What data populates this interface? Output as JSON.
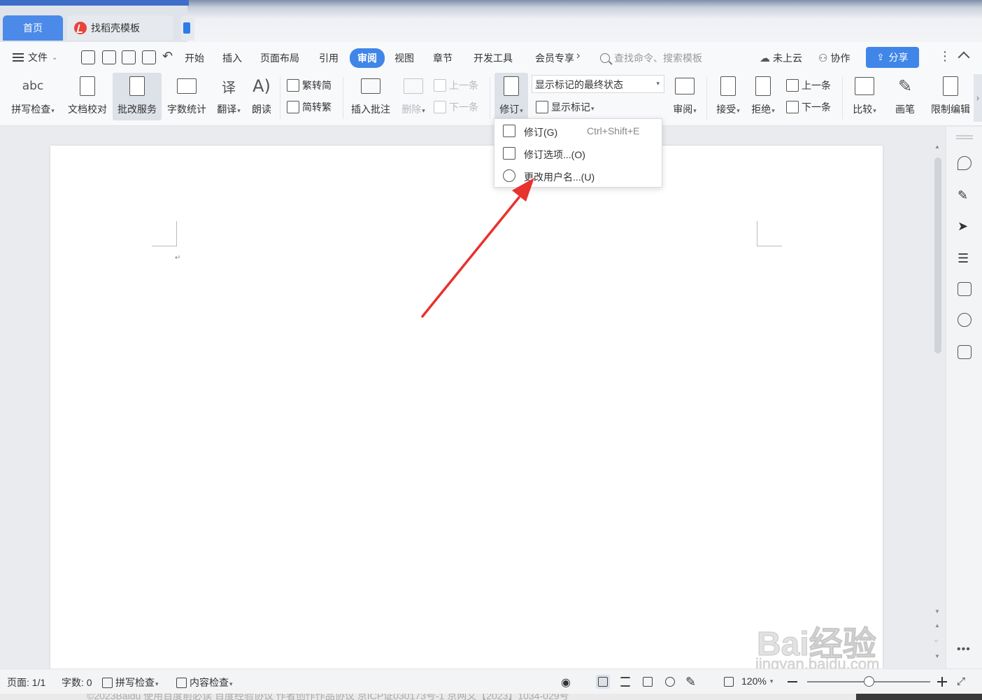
{
  "tabs": {
    "home": "首页",
    "template": "找稻壳模板"
  },
  "menu": {
    "file": "文件",
    "items": [
      "开始",
      "插入",
      "页面布局",
      "引用",
      "审阅",
      "视图",
      "章节",
      "开发工具",
      "会员专享"
    ],
    "active": "审阅",
    "search_placeholder": "查找命令、搜索模板",
    "cloud": "未上云",
    "collab": "协作",
    "share": "分享"
  },
  "ribbon": {
    "spell": "拼写检查",
    "doc_proof": "文档校对",
    "correct_service": "批改服务",
    "word_count": "字数统计",
    "translate": "翻译",
    "read_aloud": "朗读",
    "trad_to_simp": "繁转简",
    "simp_to_trad": "简转繁",
    "insert_comment": "插入批注",
    "delete": "删除",
    "prev_comment": "上一条",
    "next_comment": "下一条",
    "track": "修订",
    "display_state": "显示标记的最终状态",
    "show_markup": "显示标记",
    "review": "审阅",
    "accept": "接受",
    "reject": "拒绝",
    "prev_change": "上一条",
    "next_change": "下一条",
    "compare": "比较",
    "pen": "画笔",
    "restrict": "限制编辑"
  },
  "dropdown": {
    "items": [
      {
        "label": "修订(G)",
        "shortcut": "Ctrl+Shift+E",
        "icon": "track-changes-icon"
      },
      {
        "label": "修订选项...(O)",
        "shortcut": "",
        "icon": "track-options-icon"
      },
      {
        "label": "更改用户名...(U)",
        "shortcut": "",
        "icon": "user-edit-icon"
      }
    ]
  },
  "document": {
    "paragraph_mark": "↵"
  },
  "status": {
    "page": "页面: 1/1",
    "words": "字数: 0",
    "spell": "拼写检查",
    "content_check": "内容检查",
    "zoom": "120%"
  },
  "watermark": {
    "brand": "Bai经验",
    "url": "jingyan.baidu.com"
  },
  "footer": {
    "text": "©2023Baidu  使用百度前必读  百度经验协议  作者创作作品协议  京ICP证030173号-1 京网文【2023】1034-029号"
  },
  "colors": {
    "accent": "#3f86e8",
    "arrow": "#e8322e"
  }
}
